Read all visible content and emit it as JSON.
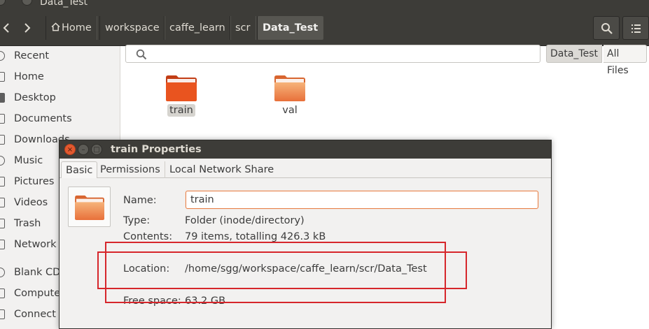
{
  "window": {
    "title": "Data_Test"
  },
  "toolbar": {
    "breadcrumbs": [
      "Home",
      "workspace",
      "caffe_learn",
      "scr",
      "Data_Test"
    ]
  },
  "sidebar": {
    "items": [
      {
        "label": "Recent",
        "icon": "clock-icon"
      },
      {
        "label": "Home",
        "icon": "home-icon"
      },
      {
        "label": "Desktop",
        "icon": "folder-icon"
      },
      {
        "label": "Documents",
        "icon": "documents-icon"
      },
      {
        "label": "Downloads",
        "icon": "downloads-icon"
      },
      {
        "label": "Music",
        "icon": "music-icon"
      },
      {
        "label": "Pictures",
        "icon": "pictures-icon"
      },
      {
        "label": "Videos",
        "icon": "videos-icon"
      },
      {
        "label": "Trash",
        "icon": "trash-icon"
      },
      {
        "label": "Network",
        "icon": "network-icon"
      },
      {
        "label": "Blank CD-",
        "icon": "disc-icon"
      },
      {
        "label": "Compute",
        "icon": "computer-icon"
      },
      {
        "label": "Connect t",
        "icon": "connect-icon"
      }
    ]
  },
  "search": {
    "placeholder": "",
    "scopes": [
      "Data_Test",
      "All Files"
    ]
  },
  "files": [
    {
      "name": "train",
      "selected": true
    },
    {
      "name": "val",
      "selected": false
    }
  ],
  "dialog": {
    "title": "train Properties",
    "tabs": [
      "Basic",
      "Permissions",
      "Local Network Share"
    ],
    "name_label": "Name:",
    "name_value": "train",
    "type_label": "Type:",
    "type_value": "Folder (inode/directory)",
    "contents_label": "Contents:",
    "contents_value": "79 items, totalling 426.3 kB",
    "location_label": "Location:",
    "location_value": "/home/sgg/workspace/caffe_learn/scr/Data_Test",
    "free_label": "Free space:",
    "free_value": "63.2 GB"
  },
  "colors": {
    "titlebar": "#3d3c38",
    "folder_orange": "#e9541f",
    "folder_light": "#f29a5a",
    "annotation_red": "#d6262b"
  }
}
